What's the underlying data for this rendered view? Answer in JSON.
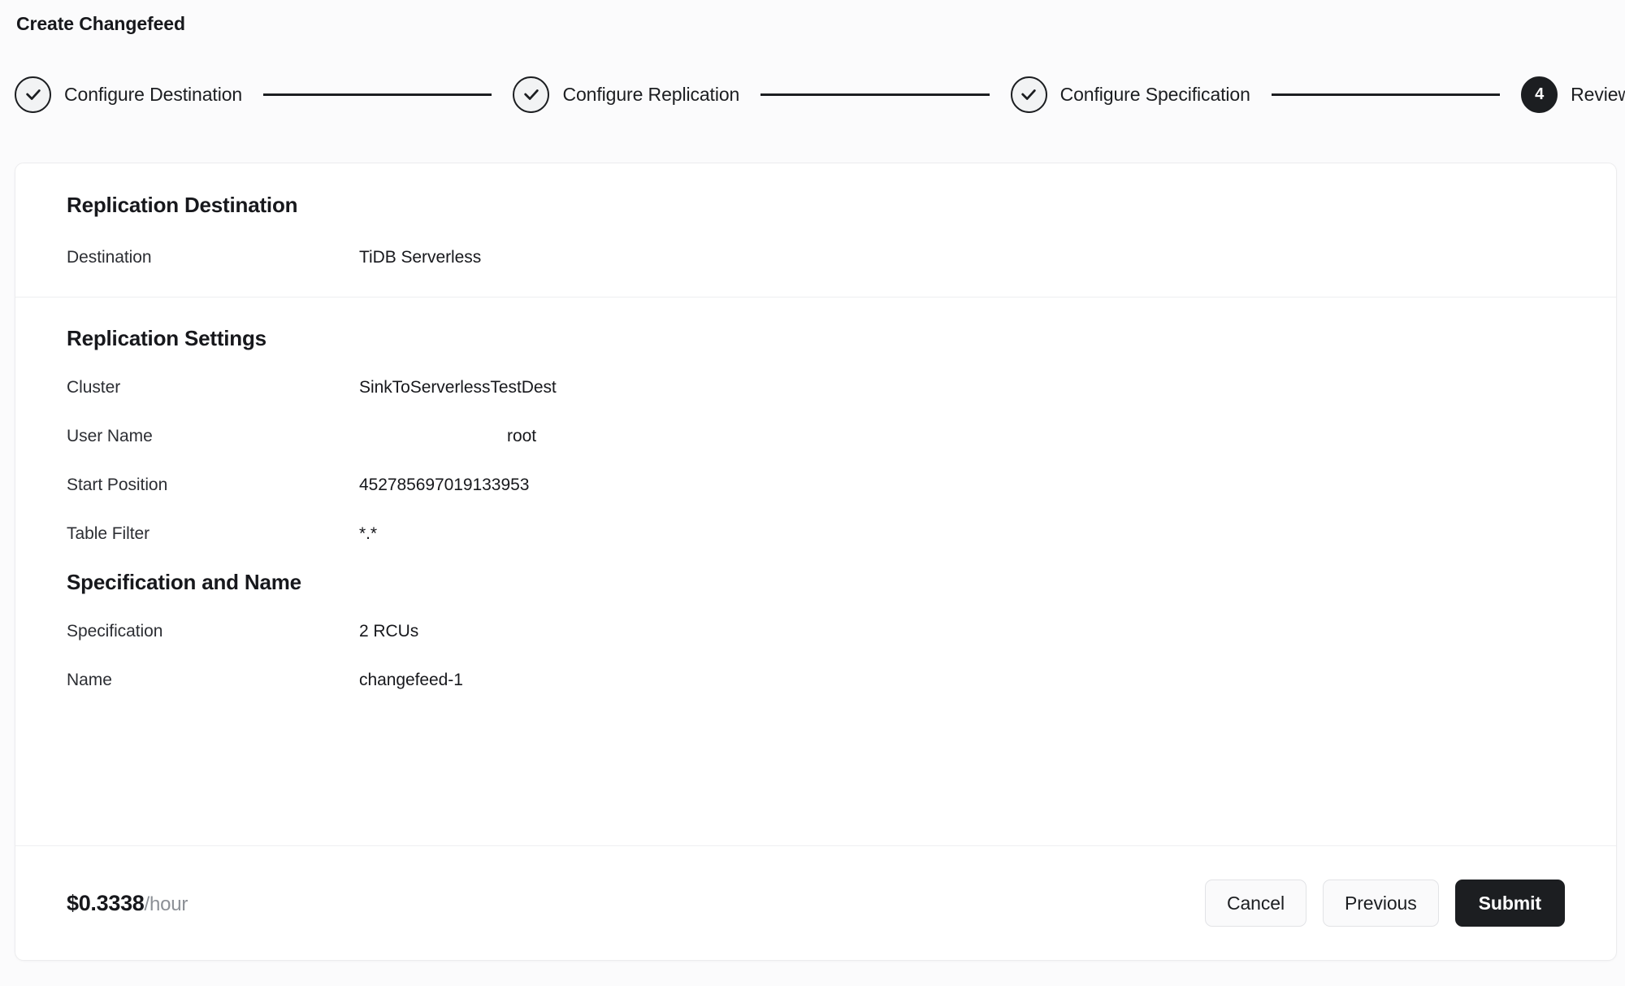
{
  "page": {
    "title": "Create Changefeed"
  },
  "stepper": {
    "steps": [
      {
        "label": "Configure Destination",
        "state": "done",
        "number": "1",
        "icon": "check-icon"
      },
      {
        "label": "Configure Replication",
        "state": "done",
        "number": "2",
        "icon": "check-icon"
      },
      {
        "label": "Configure Specification",
        "state": "done",
        "number": "3",
        "icon": "check-icon"
      },
      {
        "label": "Review",
        "state": "current",
        "number": "4",
        "icon": ""
      }
    ]
  },
  "sections": {
    "destination": {
      "title": "Replication Destination",
      "rows": [
        {
          "label": "Destination",
          "value": "TiDB Serverless"
        }
      ]
    },
    "replication_settings": {
      "title": "Replication Settings",
      "rows": [
        {
          "label": "Cluster",
          "value": "SinkToServerlessTestDest"
        },
        {
          "label": "User Name",
          "value": "root"
        },
        {
          "label": "Start Position",
          "value": "452785697019133953"
        },
        {
          "label": "Table Filter",
          "value": "*.*"
        }
      ]
    },
    "specification_and_name": {
      "title": "Specification and Name",
      "rows": [
        {
          "label": "Specification",
          "value": "2 RCUs"
        },
        {
          "label": "Name",
          "value": "changefeed-1"
        }
      ]
    }
  },
  "footer": {
    "price_amount": "$0.3338",
    "price_unit": "/hour",
    "buttons": {
      "cancel": "Cancel",
      "previous": "Previous",
      "submit": "Submit"
    }
  },
  "colors": {
    "page_background": "#fbfbfc",
    "card_background": "#ffffff",
    "accent_dark": "#1c1e21",
    "text_primary": "#17181c",
    "text_secondary": "#8c9096",
    "divider": "#eeeff1"
  }
}
